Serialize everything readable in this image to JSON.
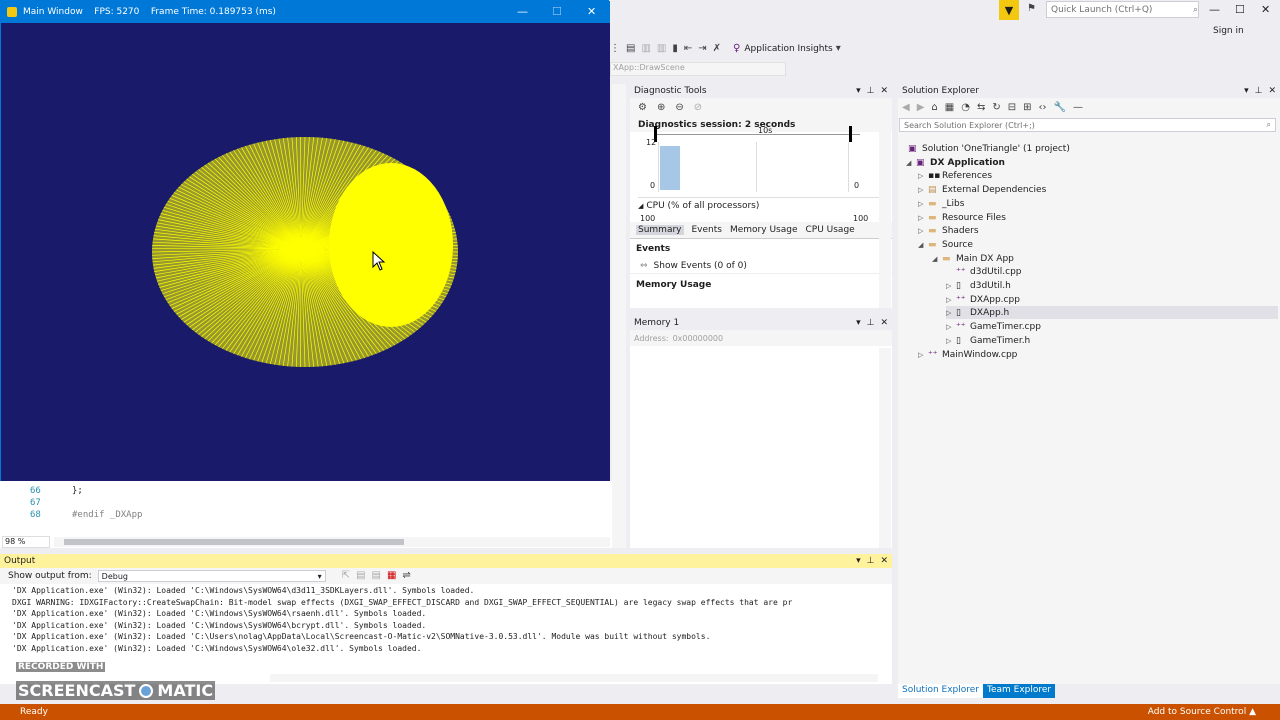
{
  "vs": {
    "quick_launch_placeholder": "Quick Launch (Ctrl+Q)",
    "sign_in": "Sign in",
    "app_insights": "Application Insights",
    "nav_combo": "XApp::DrawScene"
  },
  "dx_window": {
    "title": "Main Window    FPS: 5270    Frame Time: 0.189753 (ms)",
    "background_color": "#1a1a6b",
    "shape_color": "#ffff00"
  },
  "editor": {
    "lines": [
      {
        "num": "66",
        "text": "};"
      },
      {
        "num": "67",
        "text": ""
      },
      {
        "num": "68",
        "text": "#endif _DXApp"
      }
    ],
    "zoom": "98 %"
  },
  "diagnostic_tools": {
    "title": "Diagnostic Tools",
    "session": "Diagnostics session: 2 seconds",
    "timeline_label": "10s",
    "y_top": "12",
    "y_zero_left": "0",
    "y_zero_right": "0",
    "cpu_label": "CPU (% of all processors)",
    "cpu_top_left": "100",
    "cpu_top_right": "100",
    "tabs": [
      "Summary",
      "Events",
      "Memory Usage",
      "CPU Usage"
    ],
    "events_heading": "Events",
    "show_events": "Show Events (0 of 0)",
    "memory_heading": "Memory Usage"
  },
  "memory1": {
    "title": "Memory 1",
    "address_label": "Address:",
    "address_value": "0x00000000"
  },
  "solution_explorer": {
    "title": "Solution Explorer",
    "search_placeholder": "Search Solution Explorer (Ctrl+;)",
    "items": [
      {
        "label": "Solution 'OneTriangle' (1 project)",
        "icon": "solution-icon"
      },
      {
        "label": "DX Application",
        "icon": "project-icon"
      },
      {
        "label": "References",
        "icon": "references-icon"
      },
      {
        "label": "External Dependencies",
        "icon": "external-icon"
      },
      {
        "label": "_Libs",
        "icon": "folder-icon"
      },
      {
        "label": "Resource Files",
        "icon": "folder-icon"
      },
      {
        "label": "Shaders",
        "icon": "folder-icon"
      },
      {
        "label": "Source",
        "icon": "folder-icon"
      },
      {
        "label": "Main DX App",
        "icon": "folder-icon"
      },
      {
        "label": "d3dUtil.cpp",
        "icon": "cpp-file-icon"
      },
      {
        "label": "d3dUtil.h",
        "icon": "header-file-icon"
      },
      {
        "label": "DXApp.cpp",
        "icon": "cpp-file-icon"
      },
      {
        "label": "DXApp.h",
        "icon": "header-file-icon"
      },
      {
        "label": "GameTimer.cpp",
        "icon": "cpp-file-icon"
      },
      {
        "label": "GameTimer.h",
        "icon": "header-file-icon"
      },
      {
        "label": "MainWindow.cpp",
        "icon": "cpp-file-icon"
      }
    ],
    "tab_solution": "Solution Explorer",
    "tab_team": "Team Explorer"
  },
  "output": {
    "title": "Output",
    "show_from_label": "Show output from:",
    "source": "Debug",
    "lines": [
      "'DX Application.exe' (Win32): Loaded 'C:\\Windows\\SysWOW64\\d3d11_3SDKLayers.dll'. Symbols loaded.",
      "DXGI WARNING: IDXGIFactory::CreateSwapChain: Bit-model swap effects (DXGI_SWAP_EFFECT_DISCARD and DXGI_SWAP_EFFECT_SEQUENTIAL) are legacy swap effects that are pr",
      "'DX Application.exe' (Win32): Loaded 'C:\\Windows\\SysWOW64\\rsaenh.dll'. Symbols loaded.",
      "'DX Application.exe' (Win32): Loaded 'C:\\Windows\\SysWOW64\\bcrypt.dll'. Symbols loaded.",
      "'DX Application.exe' (Win32): Loaded 'C:\\Users\\nolag\\AppData\\Local\\Screencast-O-Matic-v2\\SOMNative-3.0.53.dll'. Module was built without symbols.",
      "'DX Application.exe' (Win32): Loaded 'C:\\Windows\\SysWOW64\\ole32.dll'. Symbols loaded."
    ]
  },
  "statusbar": {
    "left": "Ready",
    "right": "Add to Source Control"
  },
  "watermark": {
    "small": "RECORDED WITH",
    "big_left": "SCREENCAST",
    "big_right": "MATIC"
  }
}
